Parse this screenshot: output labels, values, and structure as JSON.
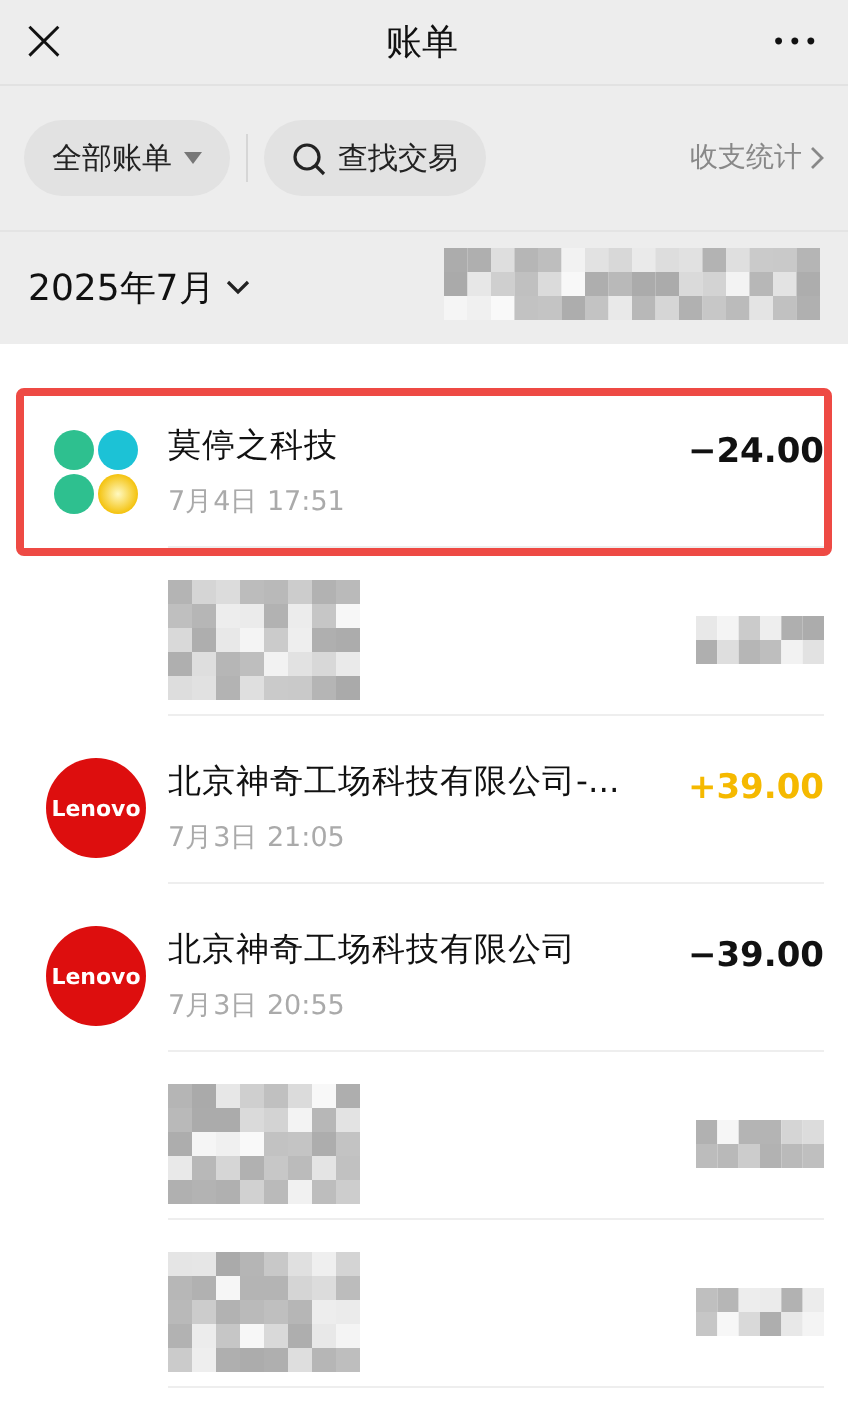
{
  "header": {
    "close_icon": "×",
    "title": "账单",
    "more": "•••"
  },
  "filters": {
    "all_bills": "全部账单",
    "search": "查找交易",
    "stats": "收支统计"
  },
  "month": {
    "label": "2025年7月",
    "redacted": true
  },
  "rows": [
    {
      "kind": "entry",
      "logo": {
        "kind": "clover"
      },
      "name": "莫停之科技",
      "time": "7月4日 17:51",
      "amount": "−24.00",
      "income": false,
      "highlighted": true
    },
    {
      "kind": "redacted"
    },
    {
      "kind": "entry",
      "logo": {
        "kind": "badge",
        "text": "Lenovo"
      },
      "name": "北京神奇工场科技有限公司-...",
      "time": "7月3日 21:05",
      "amount": "+39.00",
      "income": true,
      "highlighted": false
    },
    {
      "kind": "entry",
      "logo": {
        "kind": "badge",
        "text": "Lenovo"
      },
      "name": "北京神奇工场科技有限公司",
      "time": "7月3日 20:55",
      "amount": "−39.00",
      "income": false,
      "highlighted": false
    },
    {
      "kind": "redacted"
    },
    {
      "kind": "redacted"
    }
  ]
}
